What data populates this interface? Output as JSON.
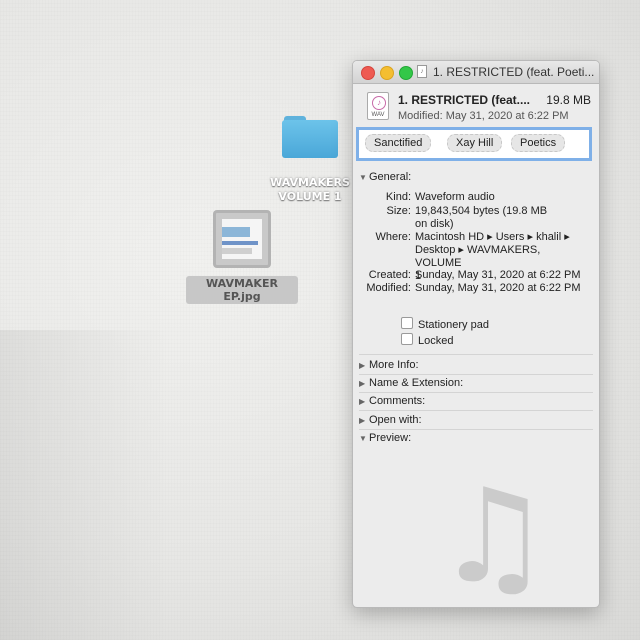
{
  "desktop": {
    "folder_label_line1": "WAVMAKERS",
    "folder_label_line2": "VOLUME 1",
    "file_label": "WAVMAKER EP.jpg"
  },
  "window": {
    "title": "1. RESTRICTED (feat. Poeti...",
    "header": {
      "name": "1. RESTRICTED (feat....",
      "size": "19.8 MB",
      "modified": "Modified: May 31, 2020 at 6:22 PM",
      "file_icon": "wav-file-icon",
      "file_icon_text": "WAV"
    },
    "tags": [
      "Sanctified",
      "Xay Hill",
      "Poetics"
    ],
    "general": {
      "label": "General:",
      "kind_key": "Kind:",
      "kind": "Waveform audio",
      "size_key": "Size:",
      "size_line1": "19,843,504 bytes (19.8 MB",
      "size_line2": "on disk)",
      "where_key": "Where:",
      "where_line1": "Macintosh HD ▸ Users ▸ khalil ▸",
      "where_line2": "Desktop ▸ WAVMAKERS, VOLUME",
      "where_line3": "1",
      "created_key": "Created:",
      "created": "Sunday, May 31, 2020 at 6:22 PM",
      "modified_key": "Modified:",
      "modified": "Sunday, May 31, 2020 at 6:22 PM",
      "stationery": "Stationery pad",
      "locked": "Locked"
    },
    "sections": {
      "more_info": "More Info:",
      "name_ext": "Name & Extension:",
      "comments": "Comments:",
      "open_with": "Open with:",
      "preview": "Preview:"
    },
    "preview_icon": "music-note-icon"
  },
  "colors": {
    "close": "#ee5a52",
    "minimize": "#f4be31",
    "zoom": "#33c748",
    "folder": "#5fb2dc",
    "tag_focus": "#7fb0e8"
  }
}
